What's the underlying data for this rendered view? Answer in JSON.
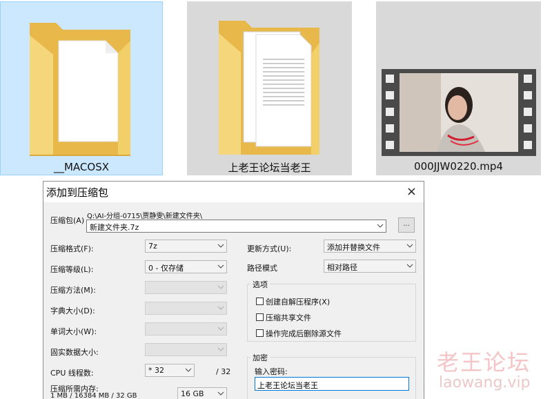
{
  "files": [
    {
      "name": "__MACOSX",
      "icon": "folder-icon"
    },
    {
      "name": "上老王论坛当老王",
      "icon": "folder-with-documents-icon"
    },
    {
      "name": "000JJW0220.mp4",
      "icon": "video-thumbnail"
    }
  ],
  "dialog": {
    "title": "添加到压缩包",
    "close": "×",
    "archive_label": "压缩包(A)",
    "archive_path": "Q:\\AI-分组-0715\\贾静雯\\新建文件夹\\",
    "archive_name": "新建文件夹.7z",
    "browse": "...",
    "format_label": "压缩格式(F):",
    "format_value": "7z",
    "level_label": "压缩等级(L):",
    "level_value": "0 - 仅存储",
    "method_label": "压缩方法(M):",
    "dict_label": "字典大小(D):",
    "word_label": "单词大小(W):",
    "solid_label": "固实数据大小:",
    "threads_label": "CPU 线程数:",
    "threads_value": "* 32",
    "threads_max": "/ 32",
    "memory_label": "压缩所需内存:",
    "memory_detail": "1 MB / 16384 MB / 32 GB",
    "memory_value": "16 GB",
    "update_label": "更新方式(U):",
    "update_value": "添加并替换文件",
    "path_label": "路径模式",
    "path_value": "相对路径",
    "options_title": "选项",
    "options": [
      "创建自解压程序(X)",
      "压缩共享文件",
      "操作完成后删除源文件"
    ],
    "encrypt_title": "加密",
    "password_label": "输入密码:",
    "password_value": "上老王论坛当老王"
  },
  "watermark": {
    "cn": "老王论坛",
    "url": "laowang.vip"
  }
}
